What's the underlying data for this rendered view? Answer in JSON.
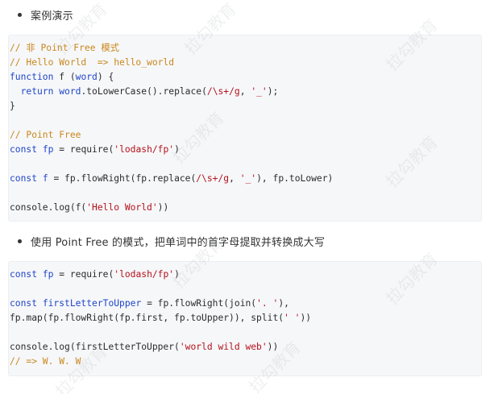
{
  "bullets": [
    "案例演示",
    "使用 Point Free 的模式，把单词中的首字母提取并转换成大写"
  ],
  "code_blocks": [
    [
      [
        {
          "t": "// 非 Point Free 模式",
          "c": "c"
        }
      ],
      [
        {
          "t": "// Hello World  => hello_world",
          "c": "c"
        }
      ],
      [
        {
          "t": "function",
          "c": "k"
        },
        {
          "t": " f (",
          "c": "p"
        },
        {
          "t": "word",
          "c": "k"
        },
        {
          "t": ") {",
          "c": "p"
        }
      ],
      [
        {
          "t": "  ",
          "c": "p"
        },
        {
          "t": "return",
          "c": "k"
        },
        {
          "t": " ",
          "c": "p"
        },
        {
          "t": "word",
          "c": "k"
        },
        {
          "t": ".toLowerCase().replace(",
          "c": "p"
        },
        {
          "t": "/\\s+/g",
          "c": "s"
        },
        {
          "t": ", ",
          "c": "p"
        },
        {
          "t": "'_'",
          "c": "s"
        },
        {
          "t": ");",
          "c": "p"
        }
      ],
      [
        {
          "t": "}",
          "c": "p"
        }
      ],
      [],
      [
        {
          "t": "// Point Free",
          "c": "c"
        }
      ],
      [
        {
          "t": "const",
          "c": "k"
        },
        {
          "t": " ",
          "c": "p"
        },
        {
          "t": "fp",
          "c": "k"
        },
        {
          "t": " = require(",
          "c": "p"
        },
        {
          "t": "'lodash/fp'",
          "c": "s"
        },
        {
          "t": ")",
          "c": "p"
        }
      ],
      [],
      [
        {
          "t": "const",
          "c": "k"
        },
        {
          "t": " ",
          "c": "p"
        },
        {
          "t": "f",
          "c": "k"
        },
        {
          "t": " = fp.flowRight(fp.replace(",
          "c": "p"
        },
        {
          "t": "/\\s+/g",
          "c": "s"
        },
        {
          "t": ", ",
          "c": "p"
        },
        {
          "t": "'_'",
          "c": "s"
        },
        {
          "t": "), fp.toLower)",
          "c": "p"
        }
      ],
      [],
      [
        {
          "t": "console.log(f(",
          "c": "p"
        },
        {
          "t": "'Hello World'",
          "c": "s"
        },
        {
          "t": "))",
          "c": "p"
        }
      ]
    ],
    [
      [
        {
          "t": "const",
          "c": "k"
        },
        {
          "t": " ",
          "c": "p"
        },
        {
          "t": "fp",
          "c": "k"
        },
        {
          "t": " = require(",
          "c": "p"
        },
        {
          "t": "'lodash/fp'",
          "c": "s"
        },
        {
          "t": ")",
          "c": "p"
        }
      ],
      [],
      [
        {
          "t": "const",
          "c": "k"
        },
        {
          "t": " ",
          "c": "p"
        },
        {
          "t": "firstLetterToUpper",
          "c": "k"
        },
        {
          "t": " = fp.flowRight(join(",
          "c": "p"
        },
        {
          "t": "'. '",
          "c": "s"
        },
        {
          "t": "),",
          "c": "p"
        }
      ],
      [
        {
          "t": "fp.map(fp.flowRight(fp.first, fp.toUpper)), split(",
          "c": "p"
        },
        {
          "t": "' '",
          "c": "s"
        },
        {
          "t": "))",
          "c": "p"
        }
      ],
      [],
      [
        {
          "t": "console.log(firstLetterToUpper(",
          "c": "p"
        },
        {
          "t": "'world wild web'",
          "c": "s"
        },
        {
          "t": "))",
          "c": "p"
        }
      ],
      [
        {
          "t": "// => W. W. W",
          "c": "c"
        }
      ]
    ]
  ],
  "watermark_text": "拉勾教育"
}
